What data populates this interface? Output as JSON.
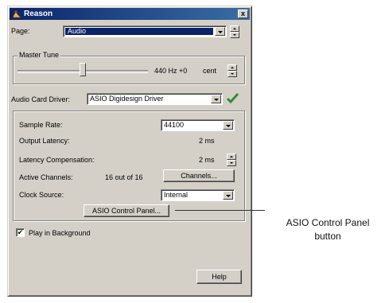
{
  "window": {
    "title": "Reason",
    "close_symbol": "x"
  },
  "page": {
    "label": "Page:",
    "value": "Audio"
  },
  "master_tune": {
    "group_label": "Master Tune",
    "value": "440 Hz +0",
    "unit": "cent",
    "slider_level": 0.5
  },
  "audio_card_driver": {
    "label": "Audio Card Driver:",
    "value": "ASIO Digidesign Driver",
    "status_icon": "checkmark-icon",
    "status_color": "#2f8f2f"
  },
  "settings": {
    "sample_rate": {
      "label": "Sample Rate:",
      "value": "44100"
    },
    "output_latency": {
      "label": "Output Latency:",
      "value": "2 ms"
    },
    "latency_compensation": {
      "label": "Latency Compensation:",
      "value": "2 ms"
    },
    "active_channels": {
      "label": "Active Channels:",
      "value": "16 out of 16",
      "button": "Channels..."
    },
    "clock_source": {
      "label": "Clock Source:",
      "value": "Internal"
    },
    "asio_button": "ASIO Control Panel..."
  },
  "play_in_background": {
    "label": "Play in Background",
    "checked": true,
    "check_symbol": "✔"
  },
  "help_button": "Help",
  "callout": {
    "line1": "ASIO Control Panel",
    "line2": "button"
  },
  "colors": {
    "titlebar": "#0a246a",
    "selection": "#0a246a",
    "dialog_bg": "#d4d0c8"
  }
}
